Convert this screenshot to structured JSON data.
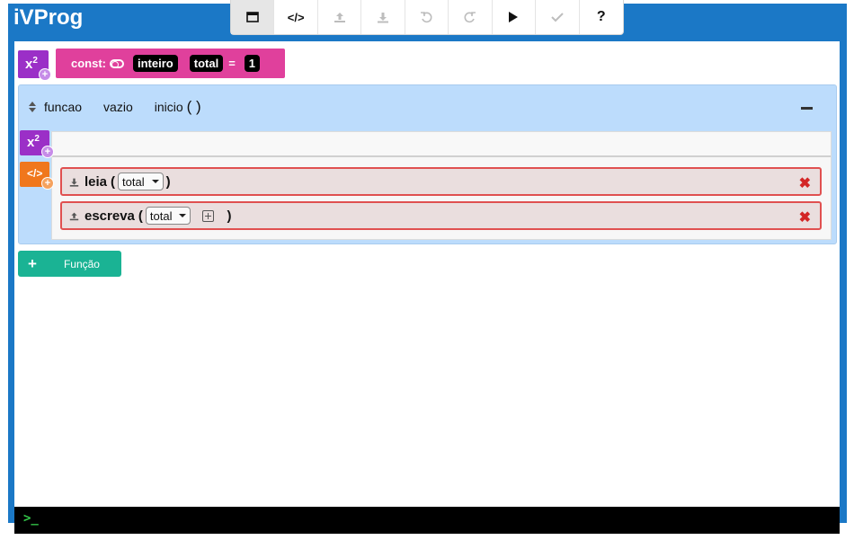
{
  "app": {
    "title": "iVProg"
  },
  "toolbar": {
    "buttons": [
      {
        "icon": "window-icon",
        "active": true
      },
      {
        "icon": "code-icon",
        "label": "</>"
      },
      {
        "icon": "upload-icon"
      },
      {
        "icon": "download-icon"
      },
      {
        "icon": "undo-icon"
      },
      {
        "icon": "redo-icon"
      },
      {
        "icon": "play-icon"
      },
      {
        "icon": "check-icon"
      },
      {
        "icon": "help-icon",
        "label": "?"
      }
    ]
  },
  "globals": {
    "add_var_label": "x",
    "add_var_sup": "2",
    "constant": {
      "prefix": "const:",
      "type": "inteiro",
      "name": "total",
      "equals": "=",
      "value": "1"
    }
  },
  "function": {
    "keyword": "funcao",
    "return_type": "vazio",
    "name": "inicio",
    "params": "( )",
    "add_cmd_label": "</>",
    "commands": [
      {
        "keyword": "leia",
        "open": "(",
        "arg": "total",
        "close": ")"
      },
      {
        "keyword": "escreva",
        "open": "(",
        "arg": "total",
        "close": ")"
      }
    ],
    "delete_glyph": "✖"
  },
  "add_function": {
    "plus": "+",
    "label": "Função"
  },
  "console": {
    "prompt": ">_"
  },
  "colors": {
    "frame": "#1b78c6",
    "var_purple": "#9b2fc7",
    "const_pink": "#e0409c",
    "func_blue": "#bcdcfc",
    "cmd_orange": "#f0771c",
    "cmd_border": "#e05050",
    "add_func_teal": "#1ab394"
  }
}
